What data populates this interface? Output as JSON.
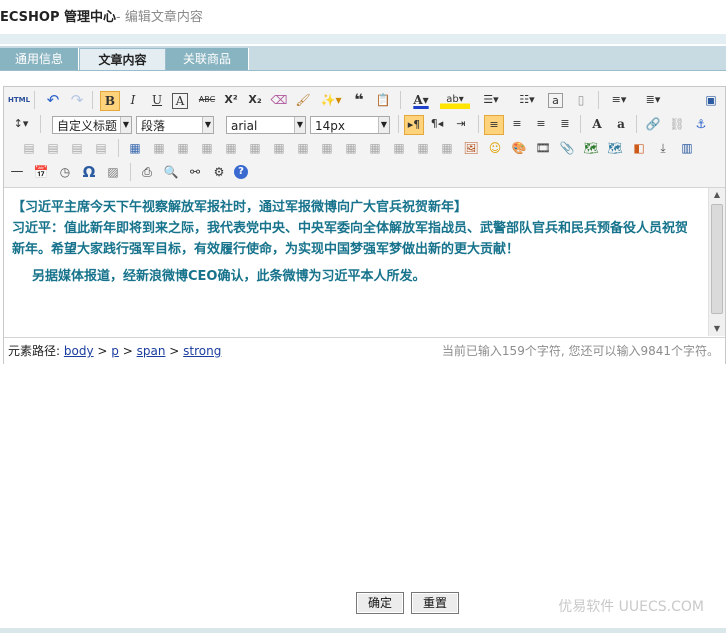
{
  "header": {
    "app_title": "ECSHOP 管理中心",
    "page_subtitle": "- 编辑文章内容"
  },
  "tabs": [
    {
      "label": "通用信息",
      "active": false
    },
    {
      "label": "文章内容",
      "active": true
    },
    {
      "label": "关联商品",
      "active": false
    }
  ],
  "toolbar": {
    "html_button": "HTML",
    "custom_heading": "自定义标题",
    "paragraph": "段落",
    "font_family": "arial",
    "font_size": "14px",
    "bold": "B",
    "italic": "I",
    "underline": "U",
    "font_border": "A",
    "strikethrough": "ABC",
    "superscript": "X²",
    "subscript": "X₂",
    "omega": "Ω"
  },
  "content": {
    "line1": "【习近平主席今天下午视察解放军报社时，通过军报微博向广大官兵祝贺新年】",
    "line2": "习近平：值此新年即将到来之际，我代表党中央、中央军委向全体解放军指战员、武警部队官兵和民兵预备役人员祝贺新年。希望大家践行强军目标，有效履行使命，为实现中国梦强军梦做出新的更大贡献！",
    "line3": "另据媒体报道，经新浪微博CEO确认，此条微博为习近平本人所发。"
  },
  "statusbar": {
    "path_label": "元素路径:",
    "path": [
      "body",
      "p",
      "span",
      "strong"
    ],
    "path_sep": ">",
    "char_count": "当前已输入159个字符, 您还可以输入9841个字符。"
  },
  "actions": {
    "confirm_label": "确定",
    "reset_label": "重置"
  },
  "watermark": "优易软件 UUECS.COM",
  "colors": {
    "content_text": "#17738c",
    "tab_bar": "#88b3c0",
    "accent_highlight": "#ffd37c"
  }
}
